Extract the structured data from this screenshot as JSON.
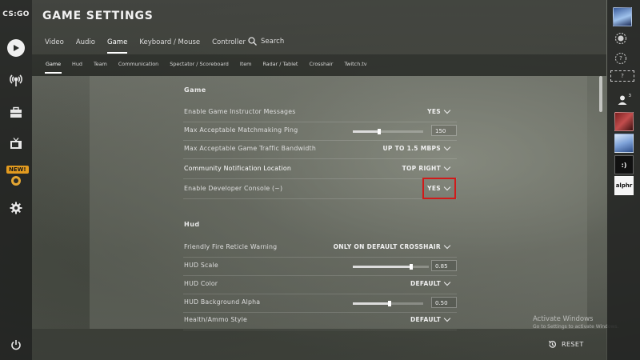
{
  "app": {
    "logo": "CS:GO",
    "title": "GAME SETTINGS"
  },
  "left_nav": {
    "items": [
      {
        "icon": "play-icon"
      },
      {
        "icon": "broadcast-icon"
      },
      {
        "icon": "inventory-icon"
      },
      {
        "icon": "tv-icon"
      },
      {
        "icon": "operation-icon",
        "badge": "NEW!"
      },
      {
        "icon": "gear-icon"
      }
    ],
    "power_icon": "power-icon"
  },
  "tabs": [
    "Video",
    "Audio",
    "Game",
    "Keyboard / Mouse",
    "Controller"
  ],
  "active_tab": "Game",
  "search": {
    "label": "Search"
  },
  "subtabs": [
    "Game",
    "Hud",
    "Team",
    "Communication",
    "Spectator / Scoreboard",
    "Item",
    "Radar / Tablet",
    "Crosshair",
    "Twitch.tv"
  ],
  "active_subtab": "Game",
  "sections": {
    "game": {
      "title": "Game",
      "rows": [
        {
          "label": "Enable Game Instructor Messages",
          "value": "YES"
        },
        {
          "label": "Max Acceptable Matchmaking Ping",
          "value": "150",
          "slider_fraction": 0.35
        },
        {
          "label": "Max Acceptable Game Traffic Bandwidth",
          "value": "UP TO 1.5 MBPS"
        },
        {
          "label": "Community Notification Location",
          "value": "TOP RIGHT"
        },
        {
          "label": "Enable Developer Console (~)",
          "value": "YES"
        }
      ]
    },
    "hud": {
      "title": "Hud",
      "rows": [
        {
          "label": "Friendly Fire Reticle Warning",
          "value": "ONLY ON DEFAULT CROSSHAIR"
        },
        {
          "label": "HUD Scale",
          "value": "0.85",
          "slider_fraction": 0.75
        },
        {
          "label": "HUD Color",
          "value": "DEFAULT"
        },
        {
          "label": "HUD Background Alpha",
          "value": "0.50",
          "slider_fraction": 0.5
        },
        {
          "label": "Health/Ammo Style",
          "value": "DEFAULT"
        }
      ]
    }
  },
  "right_bar": {
    "friends_count": "3",
    "avatar_text_dark": ":)",
    "avatar_text_light": "alphr",
    "help_label": "?"
  },
  "watermark": {
    "line1": "Activate Windows",
    "line2": "Go to Settings to activate Windows."
  },
  "reset": {
    "label": "RESET"
  },
  "colors": {
    "highlight": "#d11a1a",
    "badge": "#e39b1f"
  }
}
